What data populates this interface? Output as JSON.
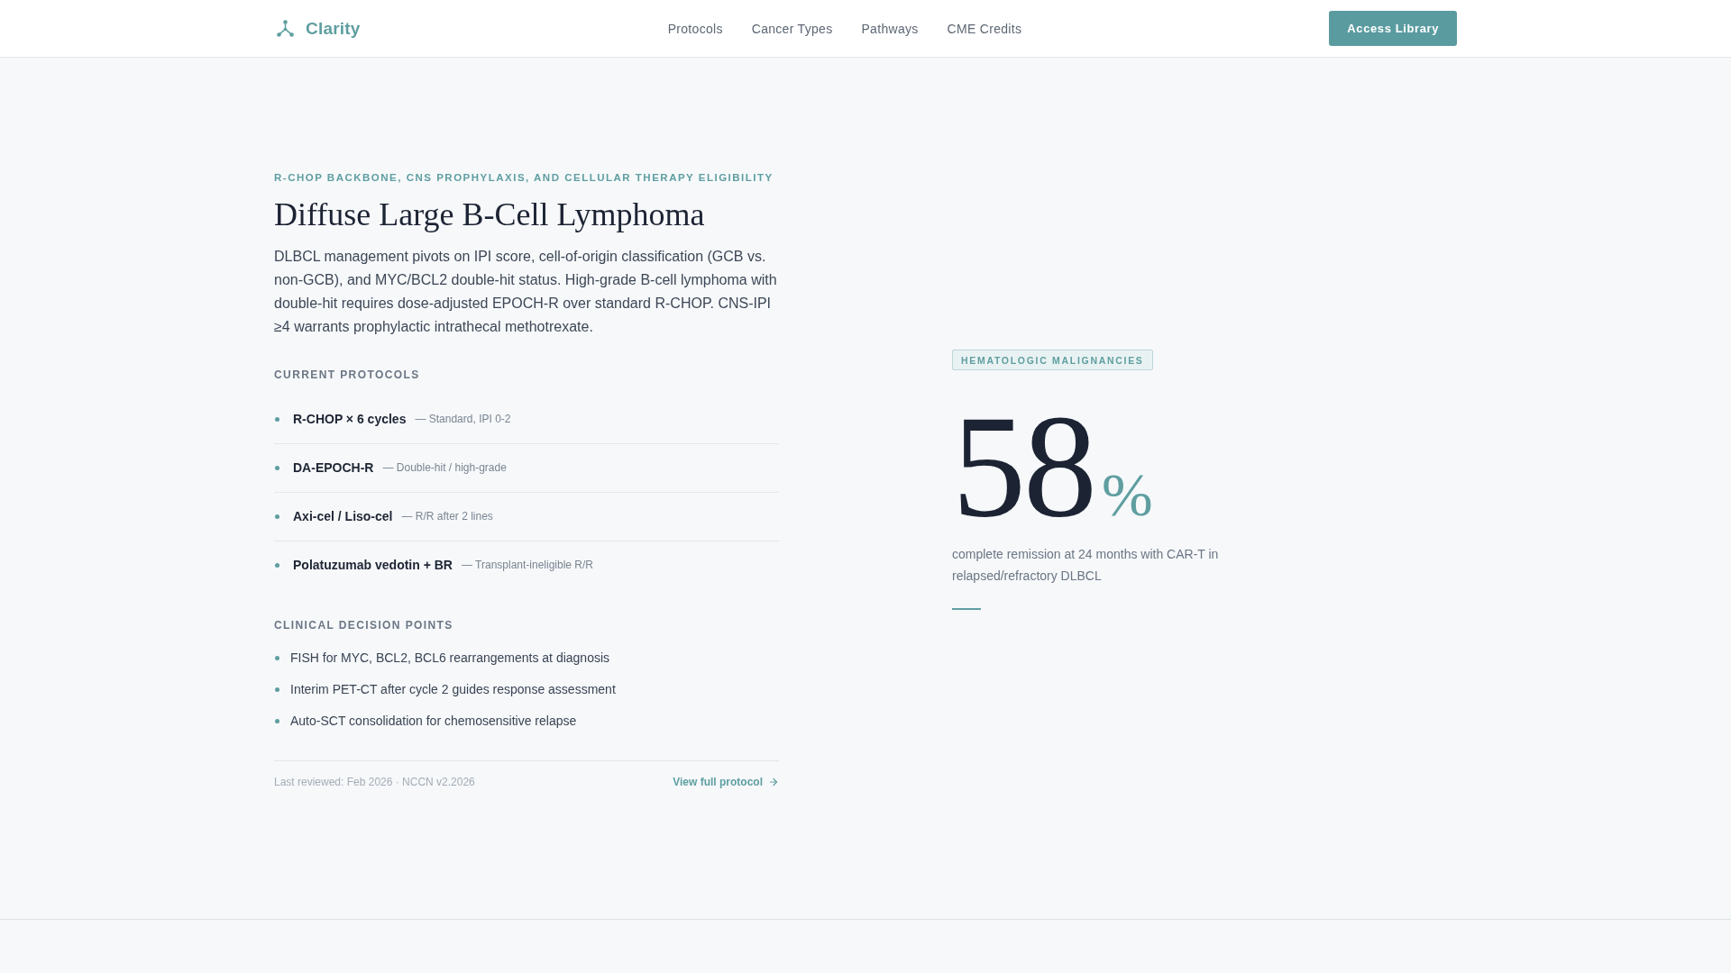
{
  "header": {
    "logo": "Clarity",
    "nav": [
      "Protocols",
      "Cancer Types",
      "Pathways",
      "CME Credits"
    ],
    "cta": "Access Library"
  },
  "overview": {
    "eyebrow": "R-CHOP BACKBONE, CNS PROPHYLAXIS, AND CELLULAR THERAPY ELIGIBILITY",
    "title": "Diffuse Large B-Cell Lymphoma",
    "summary": "DLBCL management pivots on IPI score, cell-of-origin classification (GCB vs. non-GCB), and MYC/BCL2 double-hit status. High-grade B-cell lymphoma with double-hit requires dose-adjusted EPOCH-R over standard R-CHOP. CNS-IPI ≥4 warrants prophylactic intrathecal methotrexate.",
    "protocols": {
      "heading": "CURRENT PROTOCOLS",
      "items": [
        {
          "name": "R-CHOP × 6 cycles",
          "note": "— Standard, IPI 0-2"
        },
        {
          "name": "DA-EPOCH-R",
          "note": "— Double-hit / high-grade"
        },
        {
          "name": "Axi-cel / Liso-cel",
          "note": "— R/R after 2 lines"
        },
        {
          "name": "Polatuzumab vedotin + BR",
          "note": "— Transplant-ineligible R/R"
        }
      ]
    },
    "decision_points": {
      "heading": "CLINICAL DECISION POINTS",
      "items": [
        "FISH for MYC, BCL2, BCL6 rearrangements at diagnosis",
        "Interim PET-CT after cycle 2 guides response assessment",
        "Auto-SCT consolidation for chemosensitive relapse"
      ]
    },
    "footer": {
      "meta": "Last reviewed: Feb 2026 · NCCN v2.2026",
      "link": "View full protocol"
    }
  },
  "stat": {
    "badge": "HEMATOLOGIC MALIGNANCIES",
    "value": "58",
    "unit": "%",
    "caption": "complete remission at 24 months with CAR-T in relapsed/refractory DLBCL"
  }
}
